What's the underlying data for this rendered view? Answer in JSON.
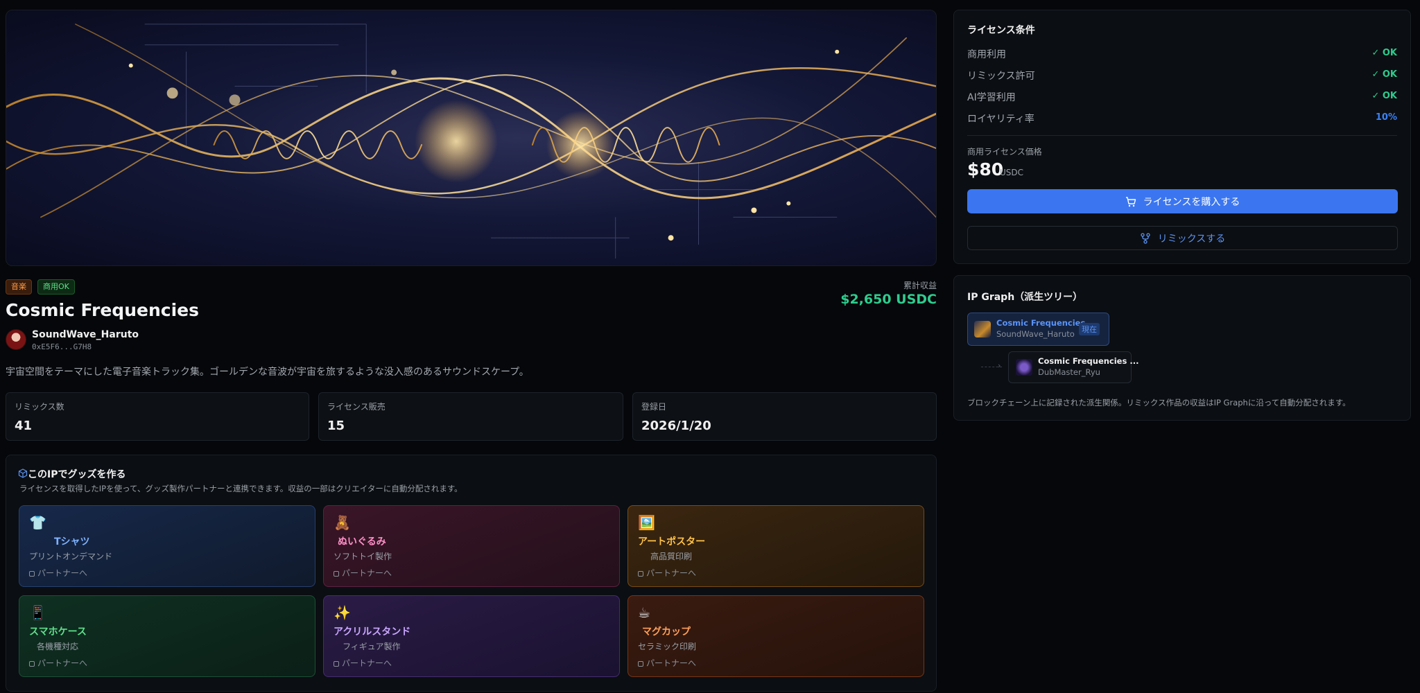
{
  "ip": {
    "tags": [
      "音楽",
      "商用OK"
    ],
    "title": "Cosmic Frequencies",
    "creator_name": "SoundWave_Haruto",
    "creator_address": "0xE5F6...G7H8",
    "description": "宇宙空間をテーマにした電子音楽トラック集。ゴールデンな音波が宇宙を旅するような没入感のあるサウンドスケープ。",
    "earnings_label": "累計収益",
    "earnings_value": "$2,650 USDC"
  },
  "stats": [
    {
      "label": "リミックス数",
      "value": "41"
    },
    {
      "label": "ライセンス販売",
      "value": "15"
    },
    {
      "label": "登録日",
      "value": "2026/1/20"
    }
  ],
  "goods": {
    "title": "このIPでグッズを作る",
    "subtitle": "ライセンスを取得したIPを使って、グッズ製作パートナーと連携できます。収益の一部はクリエイターに自動分配されます。",
    "partner_label": "パートナーへ",
    "items": [
      {
        "emoji": "👕",
        "name": "Tシャツ",
        "desc": "プリントオンデマンド",
        "color": "#7fb2ff"
      },
      {
        "emoji": "🧸",
        "name": "ぬいぐるみ",
        "desc": "ソフトトイ製作",
        "color": "#ff8fc7"
      },
      {
        "emoji": "🖼️",
        "name": "アートポスター",
        "desc": "高品質印刷",
        "color": "#ffc24a"
      },
      {
        "emoji": "📱",
        "name": "スマホケース",
        "desc": "各機種対応",
        "color": "#5ee08a"
      },
      {
        "emoji": "✨",
        "name": "アクリルスタンド",
        "desc": "フィギュア製作",
        "color": "#c9a6ff"
      },
      {
        "emoji": "☕",
        "name": "マグカップ",
        "desc": "セラミック印刷",
        "color": "#ffa05a"
      }
    ]
  },
  "license": {
    "title": "ライセンス条件",
    "rows": [
      {
        "label": "商用利用",
        "value": "✓ OK"
      },
      {
        "label": "リミックス許可",
        "value": "✓ OK"
      },
      {
        "label": "AI学習利用",
        "value": "✓ OK"
      },
      {
        "label": "ロイヤリティ率",
        "value": "10%"
      }
    ],
    "price_label": "商用ライセンス価格",
    "price": "$80",
    "price_unit": "USDC",
    "buy_label": "ライセンスを購入する",
    "remix_label": "リミックスする"
  },
  "ip_graph": {
    "title": "IP Graph（派生ツリー）",
    "root": {
      "title": "Cosmic Frequencies",
      "creator": "SoundWave_Haruto",
      "badge": "現在"
    },
    "child": {
      "title": "Cosmic Frequencies ...",
      "creator": "DubMaster_Ryu"
    },
    "footer": "ブロックチェーン上に記録された派生関係。リミックス作品の収益はIP Graphに沿って自動分配されます。"
  },
  "colors": {
    "accent": "#3b76f0",
    "ok": "#2ecc8e",
    "earnings": "#2ecc8e"
  }
}
